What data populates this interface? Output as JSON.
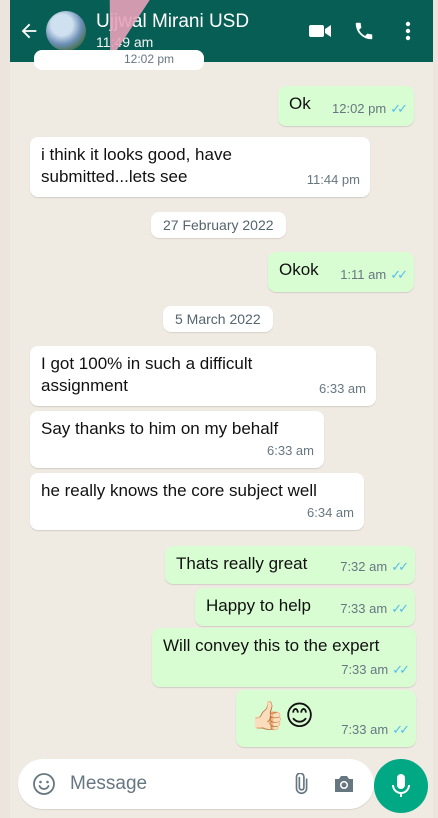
{
  "header": {
    "contact_name": "Ujjwal Mirani USD",
    "last_seen": "11:49 am"
  },
  "partial_message": {
    "time": "12:02 pm"
  },
  "messages": [
    {
      "dir": "out",
      "text": "Ok",
      "time": "12:02 pm",
      "ticks": "✓✓"
    },
    {
      "dir": "in",
      "text_line1": "i think it looks good, have",
      "text_line2": "submitted...lets see",
      "time": "11:44 pm"
    },
    {
      "dir": "out",
      "text": "Okok",
      "time": "1:11 am",
      "ticks": "✓✓"
    },
    {
      "dir": "in",
      "text_line1": "I got 100% in such a difficult",
      "text_line2": "assignment",
      "time": "6:33 am"
    },
    {
      "dir": "in",
      "text": "Say thanks to him on my behalf",
      "time": "6:33 am"
    },
    {
      "dir": "in",
      "text": "he really knows the core subject well",
      "time": "6:34 am"
    },
    {
      "dir": "out",
      "text": "Thats really great",
      "time": "7:32 am",
      "ticks": "✓✓"
    },
    {
      "dir": "out",
      "text": "Happy to help",
      "time": "7:33 am",
      "ticks": "✓✓"
    },
    {
      "dir": "out",
      "text": "Will convey this to the expert",
      "time": "7:33 am",
      "ticks": "✓✓"
    },
    {
      "dir": "out",
      "text": "👍🏻😊",
      "time": "7:33 am",
      "ticks": "✓✓"
    }
  ],
  "dates": [
    "27 February 2022",
    "5 March 2022"
  ],
  "input": {
    "placeholder": "Message"
  },
  "colors": {
    "header": "#075e54",
    "outgoing": "#d9fdd3",
    "incoming": "#ffffff",
    "accent": "#00a884",
    "read_ticks": "#53bdeb"
  }
}
